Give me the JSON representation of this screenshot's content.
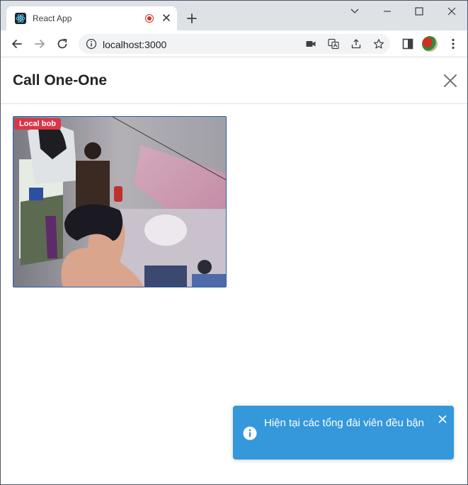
{
  "browser": {
    "tab_title": "React App",
    "url": "localhost:3000"
  },
  "icons": {
    "favicon": "react-logo-icon",
    "recording": "recording-dot-icon",
    "tab_close": "close-icon",
    "new_tab": "plus-icon",
    "back": "arrow-left-icon",
    "forward": "arrow-right-icon",
    "reload": "reload-icon",
    "site_info": "info-icon",
    "camera": "video-camera-icon",
    "translate": "translate-icon",
    "share": "share-icon",
    "bookmark": "star-icon",
    "side_panel": "side-panel-icon",
    "menu": "kebab-menu-icon"
  },
  "modal": {
    "title": "Call One-One",
    "video_label": "Local bob"
  },
  "toast": {
    "message": "Hiện tại các tổng đài viên đều bận",
    "color": "#3498db"
  },
  "colors": {
    "label_red": "#dc3545",
    "video_border": "#2b5fa8"
  }
}
